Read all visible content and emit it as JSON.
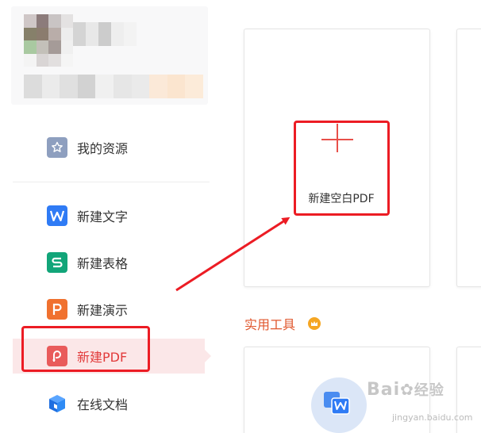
{
  "sidebar": {
    "items": [
      {
        "id": "resources",
        "label": "我的资源",
        "icon": "star-icon",
        "color": "#8e9fbf"
      },
      {
        "id": "doc",
        "label": "新建文字",
        "icon": "w-doc-icon",
        "color": "#2f7bf5"
      },
      {
        "id": "sheet",
        "label": "新建表格",
        "icon": "s-sheet-icon",
        "color": "#12a579"
      },
      {
        "id": "slides",
        "label": "新建演示",
        "icon": "p-slides-icon",
        "color": "#f0712f"
      },
      {
        "id": "pdf",
        "label": "新建PDF",
        "icon": "pdf-icon",
        "color": "#e95b5b",
        "selected": true
      },
      {
        "id": "online",
        "label": "在线文档",
        "icon": "online-doc-icon",
        "color": "#2f7bf5"
      }
    ]
  },
  "main": {
    "blank_pdf_label": "新建空白PDF",
    "tools_title": "实用工具",
    "accent_color": "#e0572d",
    "highlight_color": "#ec1c24"
  },
  "watermark": {
    "brand": "Bai",
    "brand_suffix": "经验",
    "url": "jingyan.baidu.com"
  }
}
